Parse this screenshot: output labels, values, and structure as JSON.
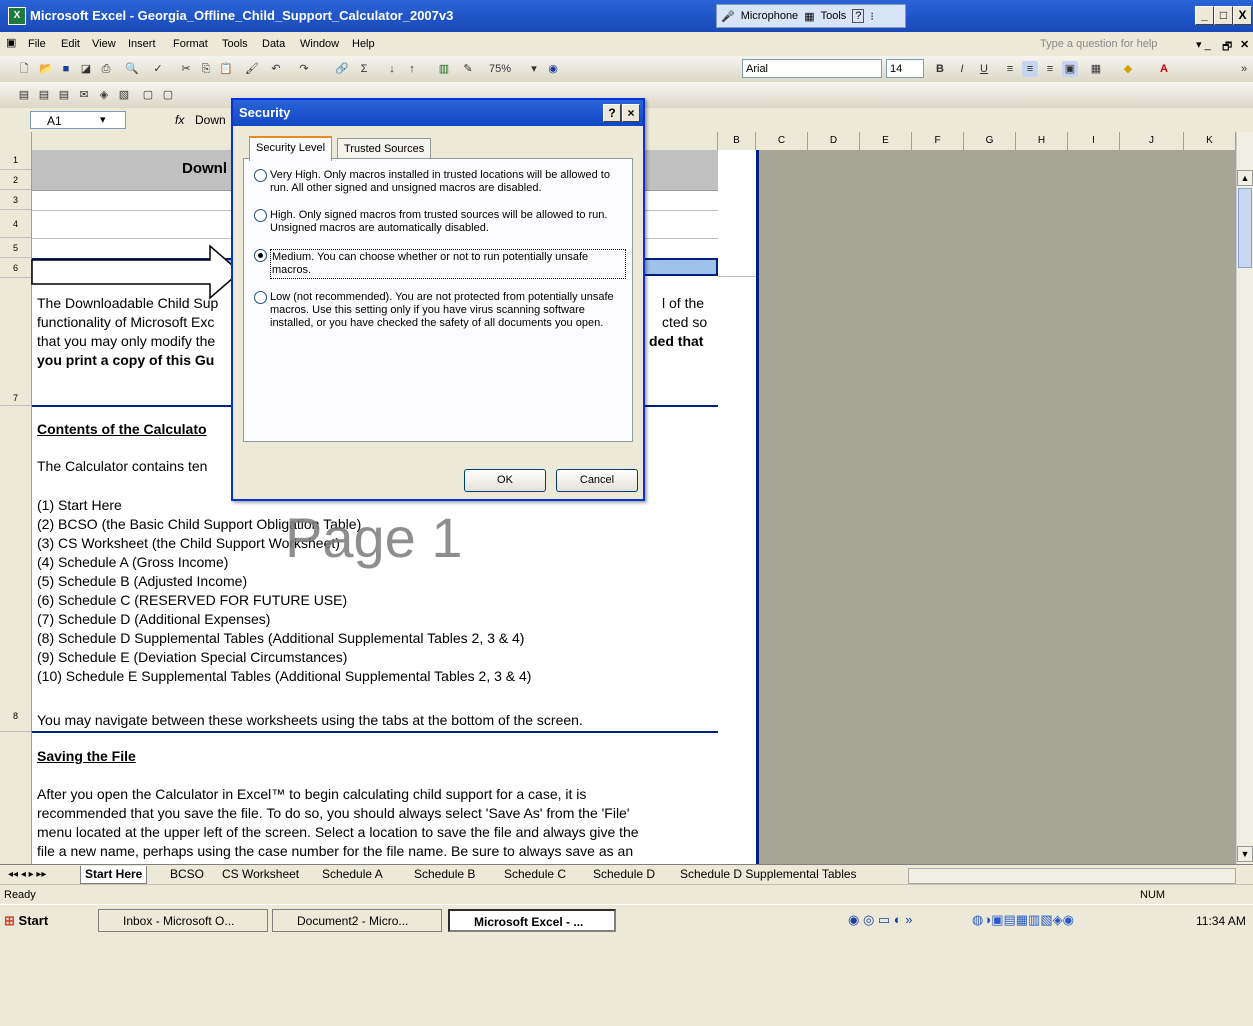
{
  "window": {
    "title": "Microsoft Excel - Georgia_Offline_Child_Support_Calculator_2007v3",
    "microphone": "Microphone",
    "tools": "Tools",
    "min": "_",
    "max": "□",
    "close": "X"
  },
  "menu": {
    "items": [
      "File",
      "Edit",
      "View",
      "Insert",
      "Format",
      "Tools",
      "Data",
      "Window",
      "Help"
    ],
    "help_placeholder": "Type a question for help"
  },
  "toolbar": {
    "zoom": "75%",
    "font": "Arial",
    "size": "14",
    "bold": "B",
    "italic": "I",
    "underline": "U"
  },
  "formula": {
    "cell": "A1",
    "fx": "fx",
    "content": "Down"
  },
  "columns": [
    "B",
    "C",
    "D",
    "E",
    "F",
    "G",
    "H",
    "I",
    "J",
    "K"
  ],
  "rows": [
    "1",
    "2",
    "3",
    "4",
    "5",
    "6",
    "7",
    "8"
  ],
  "sheet": {
    "header": "Downl",
    "para1_l1": "The Downloadable Child Sup",
    "para1_l1r": "l of the",
    "para1_l2": "functionality of Microsoft Exc",
    "para1_l2r": "cted so",
    "para1_l3": "that you may only modify the",
    "para1_l3r": "ded that",
    "para1_l4": "you print a copy of this Gu",
    "contents_heading": "Contents of the Calculato",
    "contents_intro": "The Calculator contains ten",
    "list": [
      "(1)  Start Here",
      "(2)  BCSO (the Basic Child Support Obligation Table)",
      "(3)  CS Worksheet (the Child Support Worksheet)",
      "(4)  Schedule A (Gross Income)",
      "(5)  Schedule B (Adjusted Income)",
      "(6)  Schedule C (RESERVED FOR FUTURE USE)",
      "(7)  Schedule D (Additional Expenses)",
      "(8)  Schedule D Supplemental Tables (Additional Supplemental Tables 2, 3 & 4)",
      "(9)  Schedule E (Deviation Special Circumstances)",
      "(10) Schedule E Supplemental Tables (Additional Supplemental Tables 2, 3 & 4)"
    ],
    "navigate": "You may navigate between these worksheets using the tabs at the bottom of the screen.",
    "saving_heading": "Saving the File",
    "saving_l1": "After you open the Calculator in Excel™ to begin calculating child support for a case, it is",
    "saving_l2": "recommended that you save the file. To do so, you should always select 'Save As' from the 'File'",
    "saving_l3": "menu located at the upper left of the screen. Select a location to save the file and always give the",
    "saving_l4": "file a new name, perhaps using the case number for the file name. Be sure to always save as an",
    "watermark": "Page 1"
  },
  "tabs": [
    "Start Here",
    "BCSO",
    "CS Worksheet",
    "Schedule A",
    "Schedule B",
    "Schedule C",
    "Schedule D",
    "Schedule D Supplemental Tables"
  ],
  "status": {
    "left": "Ready",
    "num": "NUM"
  },
  "taskbar": {
    "start": "Start",
    "buttons": [
      "Inbox - Microsoft O...",
      "Document2 - Micro...",
      "Microsoft Excel - ..."
    ],
    "clock": "11:34 AM"
  },
  "dialog": {
    "title": "Security",
    "help": "?",
    "close": "×",
    "tab_security": "Security Level",
    "tab_trusted": "Trusted Sources",
    "opt_veryhigh": "Very High. Only macros installed in trusted locations will be allowed to run. All other signed and unsigned macros are disabled.",
    "opt_high": "High. Only signed macros from trusted sources will be allowed to run. Unsigned macros are automatically disabled.",
    "opt_medium": "Medium. You can choose whether or not to run potentially unsafe macros.",
    "opt_low": "Low (not recommended). You are not protected from potentially unsafe macros. Use this setting only if you have virus scanning software installed, or you have checked the safety of all documents you open.",
    "selected": "Medium",
    "ok": "OK",
    "cancel": "Cancel"
  }
}
